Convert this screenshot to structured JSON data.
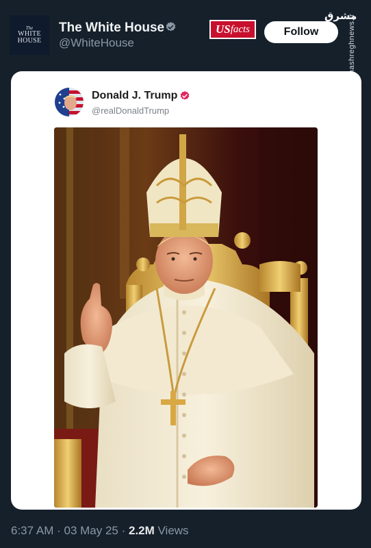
{
  "account": {
    "logo_small": "The",
    "logo_line1": "WHITE",
    "logo_line2": "HOUSE",
    "display_name": "The White House",
    "handle": "@WhiteHouse"
  },
  "usfacts": {
    "us": "US",
    "facts": "facts"
  },
  "follow_label": "Follow",
  "watermark": {
    "fa_text": "مشرق",
    "url": "mashreghnews.ir"
  },
  "embedded_post": {
    "name": "Donald J. Trump",
    "handle": "@realDonaldTrump",
    "image_subject": "pope-portrait-image"
  },
  "footer": {
    "time": "6:37 AM",
    "separator1": " · ",
    "date": "03 May 25",
    "separator2": " · ",
    "views_count": "2.2M",
    "views_label": " Views"
  },
  "colors": {
    "background": "#15202b",
    "verified_grey": "#8b98a5",
    "verified_pink": "#e0245e",
    "usfacts_red": "#c8102e"
  }
}
